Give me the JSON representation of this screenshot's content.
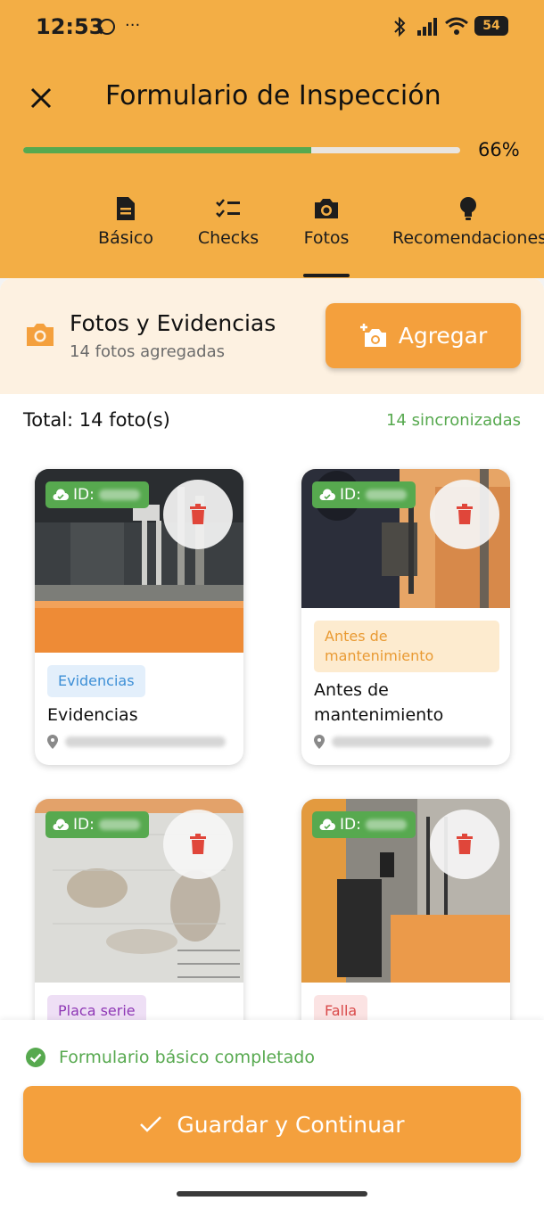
{
  "status_bar": {
    "time": "12:53",
    "battery": "54"
  },
  "header": {
    "title": "Formulario de Inspección",
    "progress_label": "66%",
    "progress": 0.66
  },
  "tabs": [
    {
      "label": "Básico",
      "icon": "document-icon"
    },
    {
      "label": "Checks",
      "icon": "checklist-icon"
    },
    {
      "label": "Fotos",
      "icon": "camera-icon",
      "active": true
    },
    {
      "label": "Recomendaciones",
      "icon": "lightbulb-icon"
    }
  ],
  "section": {
    "title": "Fotos y Evidencias",
    "subtitle": "14 fotos agregadas",
    "add_label": "Agregar"
  },
  "summary": {
    "total": "Total: 14 foto(s)",
    "synced": "14 sincronizadas"
  },
  "photos": [
    {
      "id_prefix": "ID:",
      "chip": "Evidencias",
      "title": "Evidencias",
      "chip_color": "#e3effb",
      "chip_text_color": "#3d8fd6"
    },
    {
      "id_prefix": "ID:",
      "chip": "Antes de mantenimiento",
      "title": "Antes de mantenimiento",
      "chip_color": "#fdebcf",
      "chip_text_color": "#e99a33"
    },
    {
      "id_prefix": "ID:",
      "chip": "Placa serie",
      "title": "",
      "chip_color": "#eedff5",
      "chip_text_color": "#8f38b5"
    },
    {
      "id_prefix": "ID:",
      "chip": "Falla",
      "title": "",
      "chip_color": "#fbe3e3",
      "chip_text_color": "#d94a4a"
    }
  ],
  "footer": {
    "status": "Formulario básico completado",
    "save_label": "Guardar y Continuar"
  },
  "colors": {
    "header": "#f3ae45",
    "accent": "#f4a03d",
    "success": "#57a94f",
    "danger": "#e0463a"
  }
}
